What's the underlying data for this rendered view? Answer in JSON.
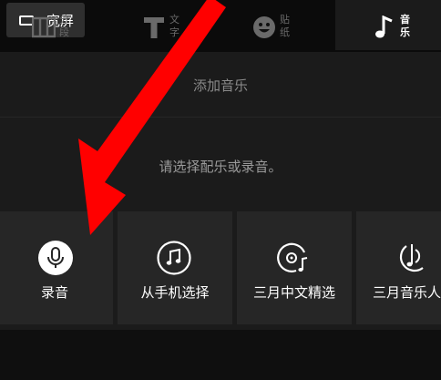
{
  "top": {
    "widescreen_label": "宽屏"
  },
  "music_panel": {
    "title": "添加音乐",
    "hint": "请选择配乐或录音。",
    "sources": [
      {
        "label": "录音",
        "icon": "microphone-icon"
      },
      {
        "label": "从手机选择",
        "icon": "music-note-icon"
      },
      {
        "label": "三月中文精选",
        "icon": "music-disc-icon"
      },
      {
        "label": "三月音乐人",
        "icon": "music-artist-icon"
      }
    ]
  },
  "tabs": [
    {
      "label": "分段",
      "icon": "film-segment-icon",
      "active": false
    },
    {
      "label": "文字",
      "icon": "text-t-icon",
      "active": false
    },
    {
      "label": "贴纸",
      "icon": "smiley-sticker-icon",
      "active": false
    },
    {
      "label": "音乐",
      "icon": "music-note-icon",
      "active": true
    }
  ],
  "colors": {
    "background": "#000000",
    "panel": "#1b1b1b",
    "card": "#262626",
    "button": "#2f2f2f",
    "muted_text": "#8a8a8a",
    "arrow": "#ff0000"
  }
}
